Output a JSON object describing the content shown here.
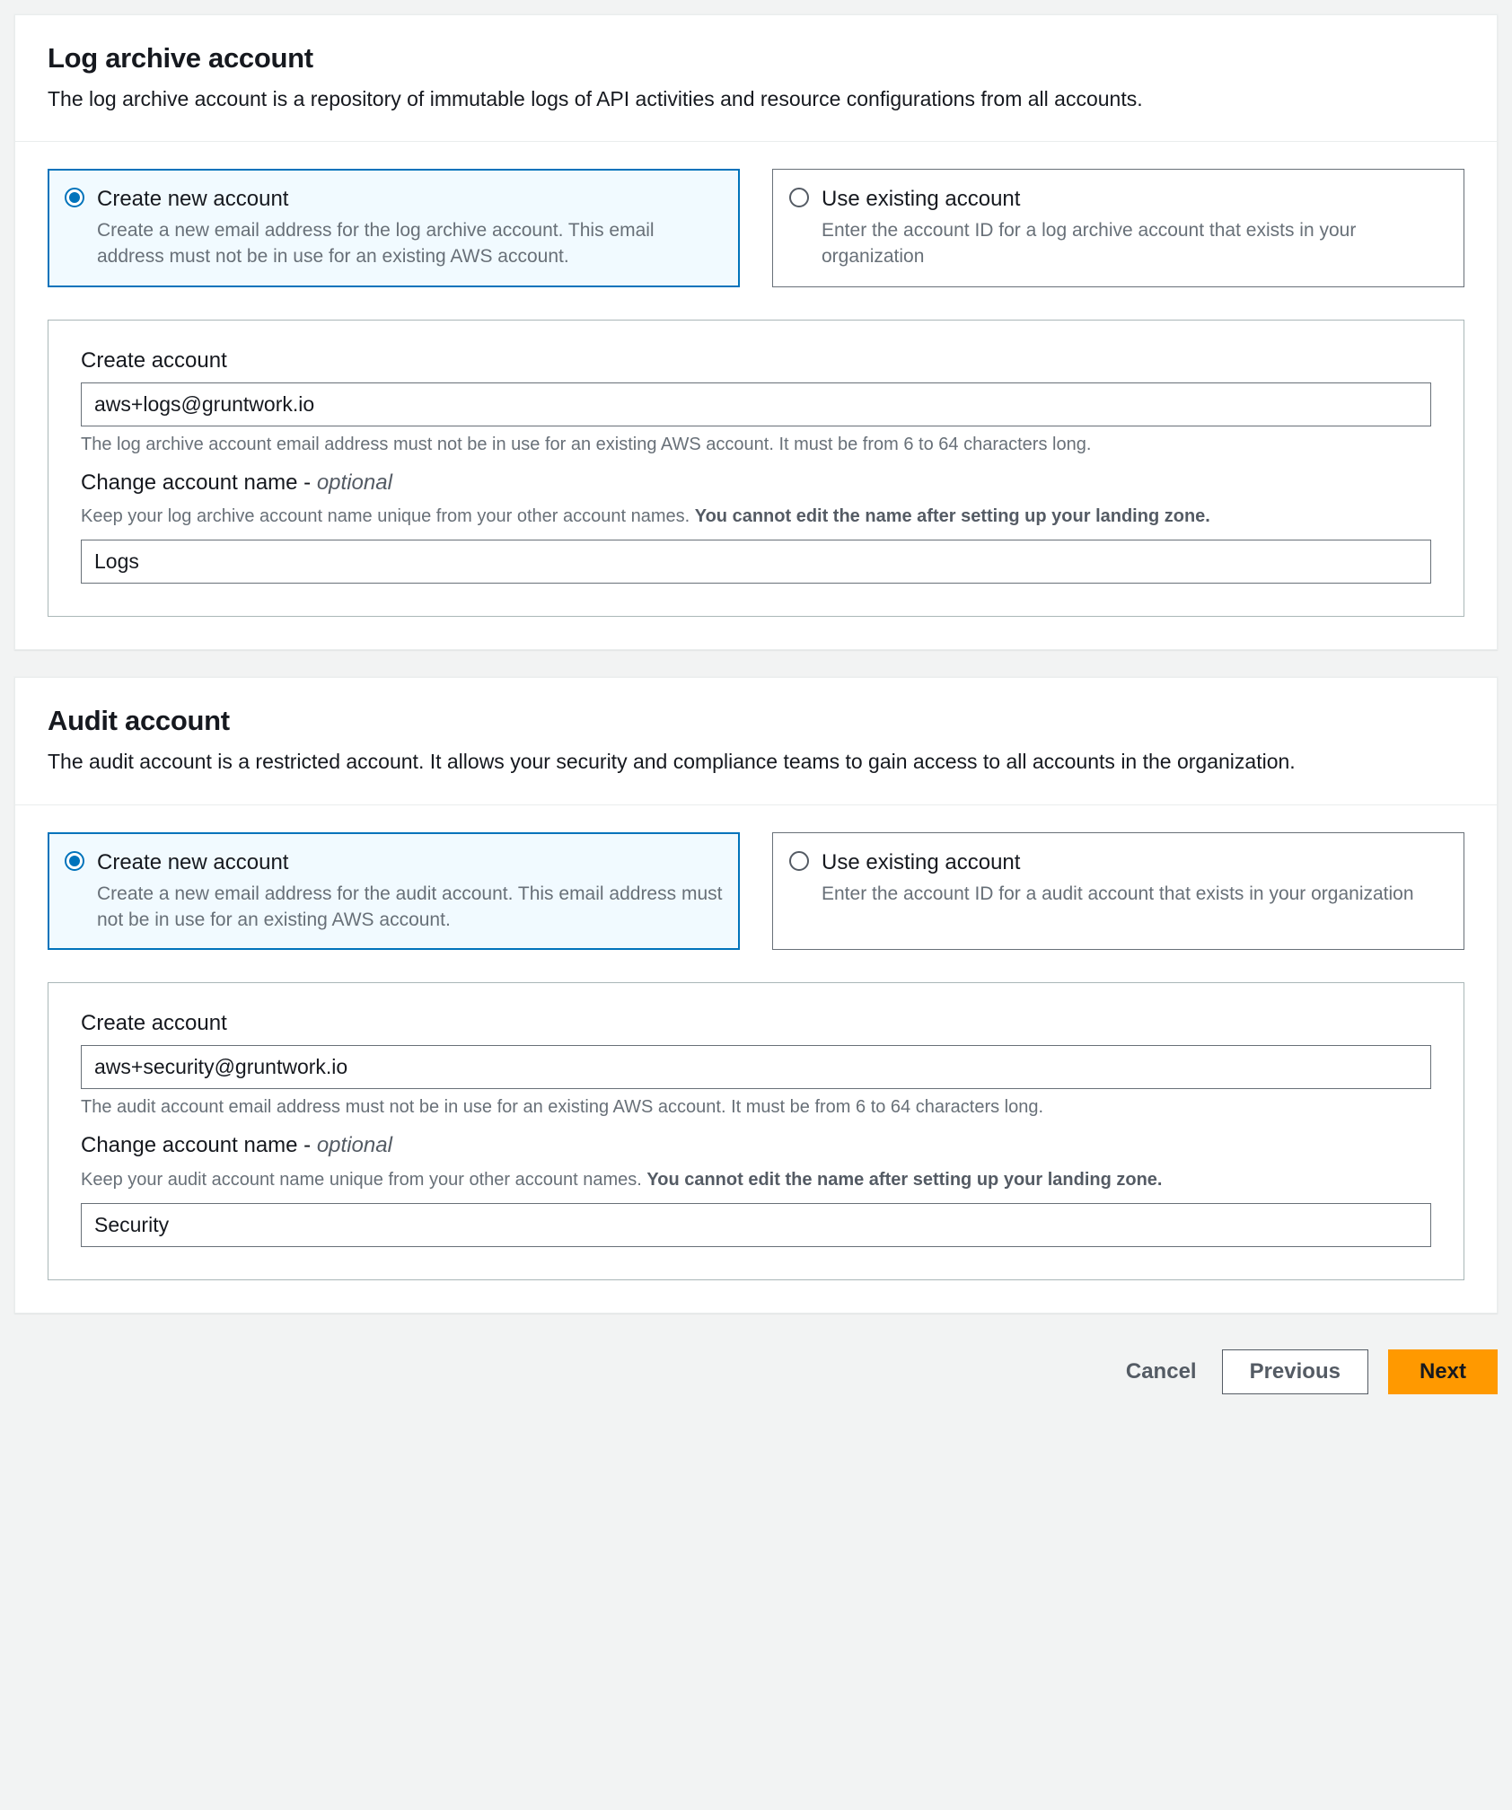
{
  "logArchive": {
    "title": "Log archive account",
    "description": "The log archive account is a repository of immutable logs of API activities and resource configurations from all accounts.",
    "options": {
      "create": {
        "title": "Create new account",
        "description": "Create a new email address for the log archive account. This email address must not be in use for an existing AWS account."
      },
      "existing": {
        "title": "Use existing account",
        "description": "Enter the account ID for a log archive account that exists in your organization"
      }
    },
    "form": {
      "emailLabel": "Create account",
      "emailValue": "aws+logs@gruntwork.io",
      "emailHint": "The log archive account email address must not be in use for an existing AWS account. It must be from 6 to 64 characters long.",
      "nameLabel": "Change account name - ",
      "nameOptional": "optional",
      "nameHintPrefix": "Keep your log archive account name unique from your other account names. ",
      "nameHintStrong": "You cannot edit the name after setting up your landing zone.",
      "nameValue": "Logs"
    }
  },
  "audit": {
    "title": "Audit account",
    "description": "The audit account is a restricted account. It allows your security and compliance teams to gain access to all accounts in the organization.",
    "options": {
      "create": {
        "title": "Create new account",
        "description": "Create a new email address for the audit account. This email address must not be in use for an existing AWS account."
      },
      "existing": {
        "title": "Use existing account",
        "description": "Enter the account ID for a audit account that exists in your organization"
      }
    },
    "form": {
      "emailLabel": "Create account",
      "emailValue": "aws+security@gruntwork.io",
      "emailHint": "The audit account email address must not be in use for an existing AWS account. It must be from 6 to 64 characters long.",
      "nameLabel": "Change account name - ",
      "nameOptional": "optional",
      "nameHintPrefix": "Keep your audit account name unique from your other account names. ",
      "nameHintStrong": "You cannot edit the name after setting up your landing zone.",
      "nameValue": "Security"
    }
  },
  "footer": {
    "cancel": "Cancel",
    "previous": "Previous",
    "next": "Next"
  }
}
